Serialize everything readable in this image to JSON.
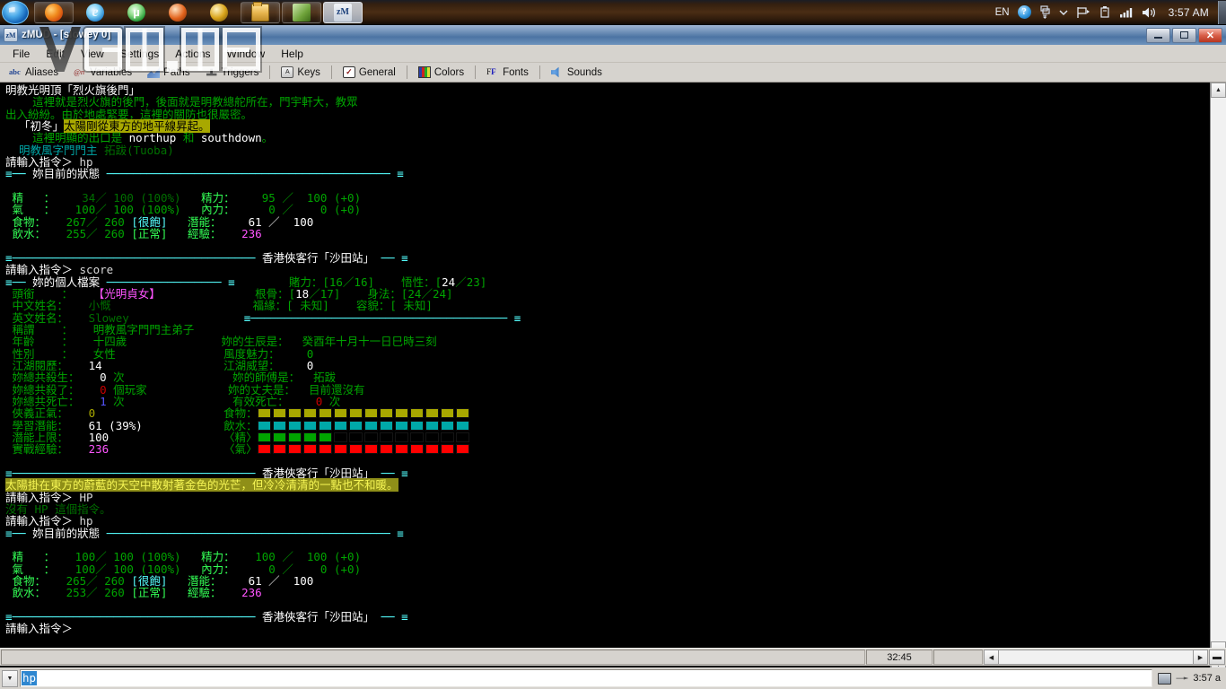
{
  "os_taskbar": {
    "start_label": "Start",
    "apps": [
      {
        "name": "firefox",
        "icon": "firefox-icon"
      },
      {
        "name": "internet-explorer",
        "icon": "ie-icon",
        "glyph": "e"
      },
      {
        "name": "utorrent",
        "icon": "utorrent-icon",
        "glyph": "µ"
      },
      {
        "name": "thunder",
        "icon": "thunder-icon"
      },
      {
        "name": "gold-app",
        "icon": "gold-app-icon"
      },
      {
        "name": "explorer",
        "icon": "folder-icon"
      },
      {
        "name": "green-app",
        "icon": "app-icon"
      },
      {
        "name": "zmud",
        "icon": "zmud-icon",
        "glyph": "zM"
      }
    ],
    "tray": {
      "language": "EN",
      "help_glyph": "?",
      "clock": "3:57 AM"
    }
  },
  "window": {
    "title": "zMUD - [slowey 0]",
    "icon_glyph": "zM",
    "buttons": {
      "minimize": "–",
      "restore": "❐",
      "close": "✕"
    }
  },
  "menu": {
    "items": [
      "File",
      "Edit",
      "View",
      "Settings",
      "Actions",
      "Window",
      "Help"
    ]
  },
  "toolbar": {
    "buttons": [
      {
        "label": "Aliases",
        "icon": "abc-icon",
        "glyph": "abc"
      },
      {
        "label": "Variables",
        "icon": "variables-icon",
        "glyph": "@n"
      },
      {
        "label": "Paths",
        "icon": "paths-icon",
        "glyph": ""
      },
      {
        "label": "Triggers",
        "icon": "triggers-icon",
        "glyph": ""
      },
      {
        "label": "Keys",
        "icon": "keys-icon",
        "glyph": "A"
      },
      {
        "label": "General",
        "icon": "general-icon",
        "glyph": "✓"
      },
      {
        "label": "Colors",
        "icon": "colors-icon",
        "glyph": ""
      },
      {
        "label": "Fonts",
        "icon": "fonts-icon",
        "glyph": "FF"
      },
      {
        "label": "Sounds",
        "icon": "sounds-icon",
        "glyph": ""
      }
    ]
  },
  "watermark": {
    "text": "VGT.me"
  },
  "terminal": {
    "lines": [
      {
        "segs": [
          {
            "t": "明教光明頂「烈火旗後門」",
            "c": "whtb"
          }
        ]
      },
      {
        "segs": [
          {
            "t": "    這裡就是烈火旗的後門，後面就是明教總舵所在，門宇軒大，教眾",
            "c": "g"
          }
        ]
      },
      {
        "segs": [
          {
            "t": "出入紛紛。由於地處緊要，這裡的關防也很嚴密。",
            "c": "g"
          }
        ]
      },
      {
        "segs": [
          {
            "t": "  「初冬」",
            "c": "whtb"
          },
          {
            "t": "太陽剛從東方的地平線昇起。",
            "c": "hl-yellow"
          }
        ]
      },
      {
        "segs": [
          {
            "t": "    這裡明顯的出口是 ",
            "c": "g"
          },
          {
            "t": "northup",
            "c": "whtb"
          },
          {
            "t": " 和 ",
            "c": "g"
          },
          {
            "t": "southdown",
            "c": "whtb"
          },
          {
            "t": "。",
            "c": "g"
          }
        ]
      },
      {
        "segs": [
          {
            "t": "  明教風字門門主 ",
            "c": "cy"
          },
          {
            "t": "拓跋(Tuoba)",
            "c": "dim"
          }
        ]
      },
      {
        "segs": [
          {
            "t": "請輸入指令＞ ",
            "c": "whtb"
          },
          {
            "t": "hp",
            "c": "wht"
          }
        ]
      },
      {
        "segs": [
          {
            "t": "≡── ",
            "c": "cyb"
          },
          {
            "t": "妳目前的狀態",
            "c": "whtb"
          },
          {
            "t": " ────────────────────────────────────────── ≡",
            "c": "cyb"
          }
        ]
      },
      {
        "segs": [
          {
            "t": "",
            "c": "g"
          }
        ]
      },
      {
        "segs": [
          {
            "t": " 精   ：  ",
            "c": "gb"
          },
          {
            "t": "  34／",
            "c": "dim"
          },
          {
            "t": " 100 ",
            "c": "dim"
          },
          {
            "t": "(100%)",
            "c": "dim"
          },
          {
            "t": "   精力：   ",
            "c": "gb"
          },
          {
            "t": " 95",
            "c": "g"
          },
          {
            "t": " ／ ",
            "c": "g"
          },
          {
            "t": " 100 ",
            "c": "g"
          },
          {
            "t": "(+0)",
            "c": "g"
          }
        ]
      },
      {
        "segs": [
          {
            "t": " 氣   ：  ",
            "c": "gb"
          },
          {
            "t": " 100／",
            "c": "g"
          },
          {
            "t": " 100 ",
            "c": "g"
          },
          {
            "t": "(100%)",
            "c": "g"
          },
          {
            "t": "   內力：   ",
            "c": "gb"
          },
          {
            "t": "  0",
            "c": "g"
          },
          {
            "t": " ／ ",
            "c": "g"
          },
          {
            "t": "   0 ",
            "c": "g"
          },
          {
            "t": "(+0)",
            "c": "g"
          }
        ]
      },
      {
        "segs": [
          {
            "t": " 食物：  ",
            "c": "gb"
          },
          {
            "t": " 267／",
            "c": "g"
          },
          {
            "t": " 260 ",
            "c": "g"
          },
          {
            "t": "[",
            "c": "cyb"
          },
          {
            "t": "很飽",
            "c": "cyb"
          },
          {
            "t": "]",
            "c": "cyb"
          },
          {
            "t": "   潛能：   ",
            "c": "gb"
          },
          {
            "t": " 61",
            "c": "whtb"
          },
          {
            "t": " ／ ",
            "c": "whtb"
          },
          {
            "t": " 100",
            "c": "whtb"
          }
        ]
      },
      {
        "segs": [
          {
            "t": " 飲水：  ",
            "c": "gb"
          },
          {
            "t": " 255／",
            "c": "g"
          },
          {
            "t": " 260 ",
            "c": "g"
          },
          {
            "t": "[",
            "c": "gb"
          },
          {
            "t": "正常",
            "c": "gb"
          },
          {
            "t": "]",
            "c": "gb"
          },
          {
            "t": "   經驗：   ",
            "c": "gb"
          },
          {
            "t": "236",
            "c": "magb"
          }
        ]
      },
      {
        "segs": [
          {
            "t": "",
            "c": "g"
          }
        ]
      },
      {
        "segs": [
          {
            "t": "≡",
            "c": "cyb"
          },
          {
            "t": "────────────────────────────────────",
            "c": "cyb"
          },
          {
            "t": " 香港俠客行「沙田站」 ",
            "c": "whtb"
          },
          {
            "t": "── ≡",
            "c": "cyb"
          }
        ]
      },
      {
        "segs": [
          {
            "t": "請輸入指令＞ ",
            "c": "whtb"
          },
          {
            "t": "score",
            "c": "wht"
          }
        ]
      },
      {
        "segs": [
          {
            "t": "≡── ",
            "c": "cyb"
          },
          {
            "t": "妳的個人檔案",
            "c": "whtb"
          },
          {
            "t": " ───────────────── ≡",
            "c": "cyb"
          },
          {
            "t": "        賭力：[16／16]    悟性：[",
            "c": "g"
          },
          {
            "t": "24",
            "c": "whtb"
          },
          {
            "t": "／23]",
            "c": "g"
          }
        ]
      },
      {
        "segs": [
          {
            "t": " 頭銜    ：   ",
            "c": "g"
          },
          {
            "t": "【光明貞女】",
            "c": "magb"
          },
          {
            "t": "              根骨：[",
            "c": "g"
          },
          {
            "t": "18",
            "c": "whtb"
          },
          {
            "t": "／17]    身法：[24／24]",
            "c": "g"
          }
        ]
      },
      {
        "segs": [
          {
            "t": " 中文姓名：   ",
            "c": "g"
          },
          {
            "t": "小慨",
            "c": "dim"
          },
          {
            "t": "                     福緣：[ 未知]    容貌：[ 未知]",
            "c": "g"
          }
        ]
      },
      {
        "segs": [
          {
            "t": " 英文姓名：   ",
            "c": "g"
          },
          {
            "t": "Slowey",
            "c": "dim"
          },
          {
            "t": "                 ≡",
            "c": "cyb"
          },
          {
            "t": "────────────────────────────────────── ≡",
            "c": "cyb"
          }
        ]
      },
      {
        "segs": [
          {
            "t": " 稱謂    ：   ",
            "c": "g"
          },
          {
            "t": "明教風字門門主弟子",
            "c": "g"
          }
        ]
      },
      {
        "segs": [
          {
            "t": " 年齡    ：   ",
            "c": "g"
          },
          {
            "t": "十四歲",
            "c": "g"
          },
          {
            "t": "              妳的生辰是：  癸酉年十月十一日巳時三刻",
            "c": "g"
          }
        ]
      },
      {
        "segs": [
          {
            "t": " 性別    ：   ",
            "c": "g"
          },
          {
            "t": "女性",
            "c": "g"
          },
          {
            "t": "                風度魅力：    ",
            "c": "g"
          },
          {
            "t": "0",
            "c": "g"
          }
        ]
      },
      {
        "segs": [
          {
            "t": " 江湖閱歷：   ",
            "c": "g"
          },
          {
            "t": "14",
            "c": "whtb"
          },
          {
            "t": "                  江湖威望：    ",
            "c": "g"
          },
          {
            "t": "0",
            "c": "whtb"
          }
        ]
      },
      {
        "segs": [
          {
            "t": " 妳總共殺生：   ",
            "c": "g"
          },
          {
            "t": "0",
            "c": "whtb"
          },
          {
            "t": " 次",
            "c": "g"
          },
          {
            "t": "                妳的師傅是：  拓跋",
            "c": "g"
          }
        ]
      },
      {
        "segs": [
          {
            "t": " 妳總共殺了：   ",
            "c": "g"
          },
          {
            "t": "0",
            "c": "red"
          },
          {
            "t": " 個玩家",
            "c": "g"
          },
          {
            "t": "            妳的丈夫是：  目前還沒有",
            "c": "g"
          }
        ]
      },
      {
        "segs": [
          {
            "t": " 妳總共死亡：   ",
            "c": "g"
          },
          {
            "t": "1",
            "c": "blub"
          },
          {
            "t": " 次",
            "c": "g"
          },
          {
            "t": "                有效死亡：    ",
            "c": "g"
          },
          {
            "t": "0",
            "c": "red"
          },
          {
            "t": " 次",
            "c": "g"
          }
        ]
      },
      {
        "segs": [
          {
            "t": " 俠義正氣：   ",
            "c": "g"
          },
          {
            "t": "0",
            "c": "yel"
          },
          {
            "t": "                   食物：",
            "c": "g"
          },
          {
            "t": "@@BAR_FOOD@@",
            "c": "bar"
          }
        ]
      },
      {
        "segs": [
          {
            "t": " 學習潛能：   ",
            "c": "g"
          },
          {
            "t": "61 (39%)",
            "c": "whtb"
          },
          {
            "t": "            飲水：",
            "c": "g"
          },
          {
            "t": "@@BAR_WATER@@",
            "c": "bar"
          }
        ]
      },
      {
        "segs": [
          {
            "t": " 潛能上限：   ",
            "c": "g"
          },
          {
            "t": "100",
            "c": "whtb"
          },
          {
            "t": "                 〈精〉",
            "c": "g"
          },
          {
            "t": "@@BAR_JING@@",
            "c": "bar"
          }
        ]
      },
      {
        "segs": [
          {
            "t": " 實戰經驗：   ",
            "c": "g"
          },
          {
            "t": "236",
            "c": "magb"
          },
          {
            "t": "                 〈氣〉",
            "c": "g"
          },
          {
            "t": "@@BAR_QI@@",
            "c": "bar"
          }
        ]
      },
      {
        "segs": [
          {
            "t": "",
            "c": "g"
          }
        ]
      },
      {
        "segs": [
          {
            "t": "≡",
            "c": "cyb"
          },
          {
            "t": "────────────────────────────────────",
            "c": "cyb"
          },
          {
            "t": " 香港俠客行「沙田站」 ",
            "c": "whtb"
          },
          {
            "t": "── ≡",
            "c": "cyb"
          }
        ]
      },
      {
        "segs": [
          {
            "t": "太陽掛在東方的蔚藍的天空中散射著金色的光芒，但冷冷清清的一點也不和暖。",
            "c": "hl-olive"
          }
        ]
      },
      {
        "segs": [
          {
            "t": "請輸入指令＞ ",
            "c": "whtb"
          },
          {
            "t": "HP",
            "c": "wht"
          }
        ]
      },
      {
        "segs": [
          {
            "t": "沒有 HP 這個指令。",
            "c": "dim"
          }
        ]
      },
      {
        "segs": [
          {
            "t": "請輸入指令＞ ",
            "c": "whtb"
          },
          {
            "t": "hp",
            "c": "wht"
          }
        ]
      },
      {
        "segs": [
          {
            "t": "≡── ",
            "c": "cyb"
          },
          {
            "t": "妳目前的狀態",
            "c": "whtb"
          },
          {
            "t": " ────────────────────────────────────────── ≡",
            "c": "cyb"
          }
        ]
      },
      {
        "segs": [
          {
            "t": "",
            "c": "g"
          }
        ]
      },
      {
        "segs": [
          {
            "t": " 精   ：  ",
            "c": "gb"
          },
          {
            "t": " 100／",
            "c": "g"
          },
          {
            "t": " 100 ",
            "c": "g"
          },
          {
            "t": "(100%)",
            "c": "g"
          },
          {
            "t": "   精力：   ",
            "c": "gb"
          },
          {
            "t": "100",
            "c": "g"
          },
          {
            "t": " ／ ",
            "c": "g"
          },
          {
            "t": " 100 ",
            "c": "g"
          },
          {
            "t": "(+0)",
            "c": "g"
          }
        ]
      },
      {
        "segs": [
          {
            "t": " 氣   ：  ",
            "c": "gb"
          },
          {
            "t": " 100／",
            "c": "g"
          },
          {
            "t": " 100 ",
            "c": "g"
          },
          {
            "t": "(100%)",
            "c": "g"
          },
          {
            "t": "   內力：   ",
            "c": "gb"
          },
          {
            "t": "  0",
            "c": "g"
          },
          {
            "t": " ／ ",
            "c": "g"
          },
          {
            "t": "   0 ",
            "c": "g"
          },
          {
            "t": "(+0)",
            "c": "g"
          }
        ]
      },
      {
        "segs": [
          {
            "t": " 食物：  ",
            "c": "gb"
          },
          {
            "t": " 265／",
            "c": "g"
          },
          {
            "t": " 260 ",
            "c": "g"
          },
          {
            "t": "[",
            "c": "cyb"
          },
          {
            "t": "很飽",
            "c": "cyb"
          },
          {
            "t": "]",
            "c": "cyb"
          },
          {
            "t": "   潛能：   ",
            "c": "gb"
          },
          {
            "t": " 61",
            "c": "whtb"
          },
          {
            "t": " ／ ",
            "c": "whtb"
          },
          {
            "t": " 100",
            "c": "whtb"
          }
        ]
      },
      {
        "segs": [
          {
            "t": " 飲水：  ",
            "c": "gb"
          },
          {
            "t": " 253／",
            "c": "g"
          },
          {
            "t": " 260 ",
            "c": "g"
          },
          {
            "t": "[",
            "c": "gb"
          },
          {
            "t": "正常",
            "c": "gb"
          },
          {
            "t": "]",
            "c": "gb"
          },
          {
            "t": "   經驗：   ",
            "c": "gb"
          },
          {
            "t": "236",
            "c": "magb"
          }
        ]
      },
      {
        "segs": [
          {
            "t": "",
            "c": "g"
          }
        ]
      },
      {
        "segs": [
          {
            "t": "≡",
            "c": "cyb"
          },
          {
            "t": "────────────────────────────────────",
            "c": "cyb"
          },
          {
            "t": " 香港俠客行「沙田站」 ",
            "c": "whtb"
          },
          {
            "t": "── ≡",
            "c": "cyb"
          }
        ]
      },
      {
        "segs": [
          {
            "t": "請輸入指令＞",
            "c": "whtb"
          }
        ]
      }
    ],
    "bars": {
      "food": {
        "total": 14,
        "filled": 14,
        "color": "#a8a800"
      },
      "water": {
        "total": 14,
        "filled": 14,
        "color": "#00a8a8"
      },
      "jing": {
        "total": 14,
        "filled": 5,
        "color": "#00a400"
      },
      "qi": {
        "total": 14,
        "filled": 14,
        "color": "#ff0000"
      }
    }
  },
  "status_bar": {
    "timer": "32:45"
  },
  "command": {
    "value": "hp",
    "dropdown_glyph": "▼"
  },
  "bottom_tray": {
    "clock": "3:57 a"
  },
  "colors": {
    "terminal_bg": "#000000",
    "green": "#00a400",
    "bright_white": "#ffffff",
    "cyan": "#55ffff",
    "magenta": "#ff55ff",
    "highlight_yellow": "#a8a800",
    "selection_blue": "#2f87d0",
    "window_chrome": "#d6d3ce"
  }
}
